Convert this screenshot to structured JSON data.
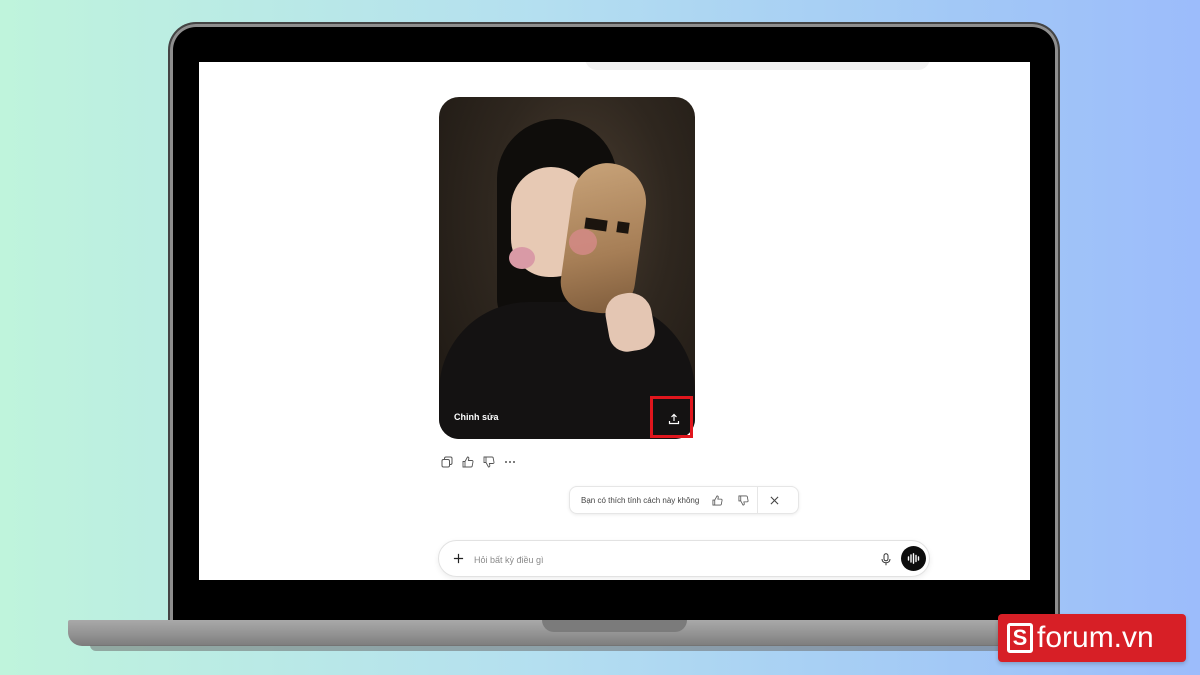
{
  "image_card": {
    "edit_label": "Chỉnh sửa"
  },
  "feedback": {
    "question": "Bạn có thích tính cách này không"
  },
  "composer": {
    "placeholder": "Hỏi bất kỳ điều gì"
  },
  "watermark": {
    "letter": "S",
    "text": "forum.vn"
  },
  "colors": {
    "highlight": "#e0161d",
    "logo_bg": "#d71f26"
  },
  "icons": [
    "share-upload-icon",
    "copy-icon",
    "thumbs-up-icon",
    "thumbs-down-icon",
    "more-icon",
    "close-icon",
    "plus-icon",
    "mic-icon",
    "voice-wave-icon"
  ]
}
